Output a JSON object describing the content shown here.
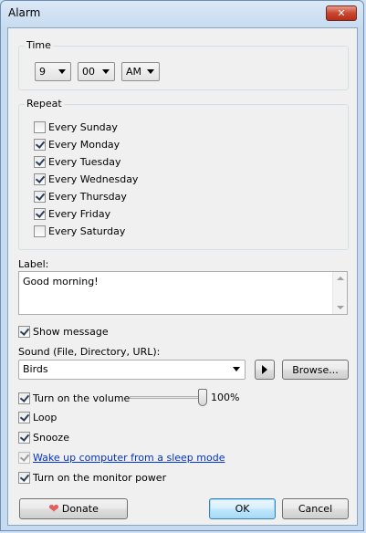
{
  "window": {
    "title": "Alarm",
    "close_glyph": "✕"
  },
  "time": {
    "group_label": "Time",
    "hour": "9",
    "minute": "00",
    "ampm": "AM"
  },
  "repeat": {
    "group_label": "Repeat",
    "days": [
      {
        "label": "Every Sunday",
        "checked": false
      },
      {
        "label": "Every Monday",
        "checked": true
      },
      {
        "label": "Every Tuesday",
        "checked": true
      },
      {
        "label": "Every Wednesday",
        "checked": true
      },
      {
        "label": "Every Thursday",
        "checked": true
      },
      {
        "label": "Every Friday",
        "checked": true
      },
      {
        "label": "Every Saturday",
        "checked": false
      }
    ]
  },
  "label_field": {
    "caption": "Label:",
    "value": "Good morning!"
  },
  "show_message": {
    "label": "Show message",
    "checked": true
  },
  "sound": {
    "caption": "Sound (File, Directory, URL):",
    "value": "Birds",
    "browse_label": "Browse..."
  },
  "volume": {
    "label": "Turn on the volume",
    "checked": true,
    "level_percent": 100,
    "level_text": "100%"
  },
  "loop": {
    "label": "Loop",
    "checked": true
  },
  "snooze": {
    "label": "Snooze",
    "checked": true
  },
  "wake": {
    "label": "Wake up computer from a sleep mode",
    "checked": true,
    "disabled": true
  },
  "monitor": {
    "label": "Turn on the monitor power",
    "checked": true
  },
  "buttons": {
    "donate": "Donate",
    "ok": "OK",
    "cancel": "Cancel"
  },
  "icons": {
    "heart": "❤"
  }
}
